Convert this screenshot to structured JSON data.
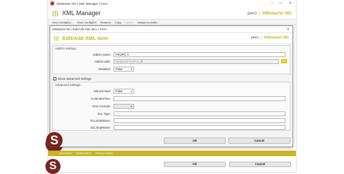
{
  "main_window": {
    "title": "SIMstarter NG | XML Manager | FSX+",
    "window_buttons": [
      "–",
      "□",
      "✕"
    ],
    "banner_bars": "|||",
    "banner_title": "XML Manager",
    "user": "pero",
    "separator": "|",
    "brand": "SIMstarter NG",
    "toolbar": [
      "New ConfigSet...",
      "Save ConfigSet",
      "Rename",
      "Copy",
      "Delete",
      "Assign to profile..."
    ],
    "bottom_tabs": [
      "Add AddOn",
      "Modify AddOn",
      "Remove AddOn"
    ],
    "ok_label": "Ok",
    "cancel_label": "Cancel",
    "logo_letter": "S"
  },
  "dialog": {
    "title": "SIMstarter NG | Edit/Add XML item > FSX+",
    "close_glyph": "✕",
    "banner_bars": "|||",
    "banner_title": "Edit/Add XML item",
    "user": "pero",
    "separator": "|",
    "brand": "SIMstarter NG",
    "addon_group_title": "AddOn settings",
    "addon_name_label": "AddOn name:",
    "addon_name_value": "FSUIPC 4",
    "addon_path_label": "AddOn path:",
    "addon_path_value": "Modules\\FSUIPC4.dll",
    "disabled_label": "Disabled:",
    "disabled_value": "False",
    "show_advanced_label": "Show advanced settings",
    "show_advanced_checked": true,
    "check_glyph": "✓",
    "advanced_group_title": "Advanced settings",
    "manual_load_label": "Manual load:",
    "manual_load_value": "False",
    "command_line_label": "Command line:",
    "command_line_value": "",
    "new_console_label": "New Console:",
    "new_console_value": "",
    "dll_type_label": "DLL Type:",
    "dll_type_value": "",
    "dll_start_label": "DLLStartName:",
    "dll_start_value": "",
    "dll_stop_label": "DLLStopName:",
    "dll_stop_value": "",
    "dropdown_glyph": "▾",
    "ok_label": "Ok",
    "cancel_label": "Cancel",
    "logo_letter": "S"
  },
  "colors": {
    "accent": "#c8b520",
    "browse_button": "#f2e200",
    "logo": "#7a2420"
  }
}
